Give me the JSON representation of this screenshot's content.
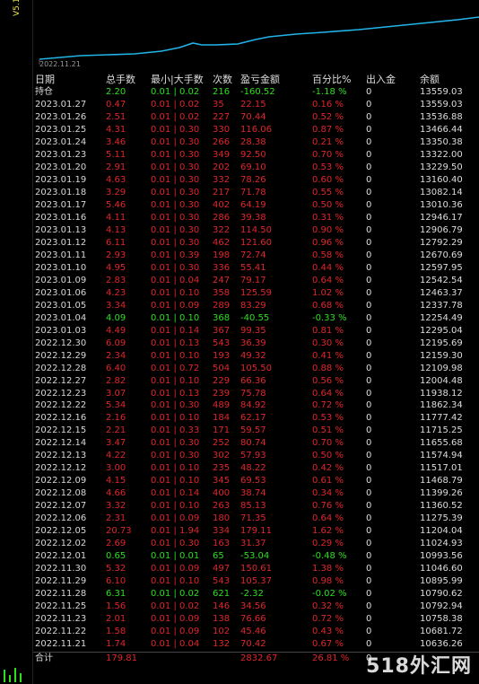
{
  "version": "V5.15",
  "chart_date": "2022.11.21",
  "watermark": "518外汇网",
  "header": [
    "日期",
    "总手数",
    "最小|大手数",
    "次数",
    "盈亏金额",
    "百分比%",
    "出入金",
    "余额"
  ],
  "open_row": {
    "date": "持仓",
    "lots": "2.20",
    "minmax": "0.01 | 0.02",
    "count": "216",
    "pl": "-160.52",
    "pct": "-1.18 %",
    "flow": "0",
    "balance": "13559.03"
  },
  "rows": [
    [
      "2023.01.27",
      "0.47",
      "0.01 | 0.02",
      "35",
      "22.15",
      "0.16 %",
      "0",
      "13559.03"
    ],
    [
      "2023.01.26",
      "2.51",
      "0.01 | 0.02",
      "227",
      "70.44",
      "0.52 %",
      "0",
      "13536.88"
    ],
    [
      "2023.01.25",
      "4.31",
      "0.01 | 0.30",
      "330",
      "116.06",
      "0.87 %",
      "0",
      "13466.44"
    ],
    [
      "2023.01.24",
      "3.46",
      "0.01 | 0.30",
      "266",
      "28.38",
      "0.21 %",
      "0",
      "13350.38"
    ],
    [
      "2023.01.23",
      "5.11",
      "0.01 | 0.30",
      "349",
      "92.50",
      "0.70 %",
      "0",
      "13322.00"
    ],
    [
      "2023.01.20",
      "2.91",
      "0.01 | 0.30",
      "202",
      "69.10",
      "0.53 %",
      "0",
      "13229.50"
    ],
    [
      "2023.01.19",
      "4.63",
      "0.01 | 0.30",
      "332",
      "78.26",
      "0.60 %",
      "0",
      "13160.40"
    ],
    [
      "2023.01.18",
      "3.29",
      "0.01 | 0.30",
      "217",
      "71.78",
      "0.55 %",
      "0",
      "13082.14"
    ],
    [
      "2023.01.17",
      "5.46",
      "0.01 | 0.30",
      "402",
      "64.19",
      "0.50 %",
      "0",
      "13010.36"
    ],
    [
      "2023.01.16",
      "4.11",
      "0.01 | 0.30",
      "286",
      "39.38",
      "0.31 %",
      "0",
      "12946.17"
    ],
    [
      "2023.01.13",
      "4.13",
      "0.01 | 0.30",
      "322",
      "114.50",
      "0.90 %",
      "0",
      "12906.79"
    ],
    [
      "2023.01.12",
      "6.11",
      "0.01 | 0.30",
      "462",
      "121.60",
      "0.96 %",
      "0",
      "12792.29"
    ],
    [
      "2023.01.11",
      "2.93",
      "0.01 | 0.39",
      "198",
      "72.74",
      "0.58 %",
      "0",
      "12670.69"
    ],
    [
      "2023.01.10",
      "4.95",
      "0.01 | 0.30",
      "336",
      "55.41",
      "0.44 %",
      "0",
      "12597.95"
    ],
    [
      "2023.01.09",
      "2.83",
      "0.01 | 0.04",
      "247",
      "79.17",
      "0.64 %",
      "0",
      "12542.54"
    ],
    [
      "2023.01.06",
      "4.23",
      "0.01 | 0.10",
      "358",
      "125.59",
      "1.02 %",
      "0",
      "12463.37"
    ],
    [
      "2023.01.05",
      "3.34",
      "0.01 | 0.09",
      "289",
      "83.29",
      "0.68 %",
      "0",
      "12337.78"
    ],
    [
      "2023.01.04",
      "4.09",
      "0.01 | 0.10",
      "368",
      "-40.55",
      "-0.33 %",
      "0",
      "12254.49"
    ],
    [
      "2023.01.03",
      "4.49",
      "0.01 | 0.14",
      "367",
      "99.35",
      "0.81 %",
      "0",
      "12295.04"
    ],
    [
      "2022.12.30",
      "6.09",
      "0.01 | 0.13",
      "543",
      "36.39",
      "0.30 %",
      "0",
      "12195.69"
    ],
    [
      "2022.12.29",
      "2.34",
      "0.01 | 0.10",
      "193",
      "49.32",
      "0.41 %",
      "0",
      "12159.30"
    ],
    [
      "2022.12.28",
      "6.40",
      "0.01 | 0.72",
      "504",
      "105.50",
      "0.88 %",
      "0",
      "12109.98"
    ],
    [
      "2022.12.27",
      "2.82",
      "0.01 | 0.10",
      "229",
      "66.36",
      "0.56 %",
      "0",
      "12004.48"
    ],
    [
      "2022.12.23",
      "3.07",
      "0.01 | 0.13",
      "239",
      "75.78",
      "0.64 %",
      "0",
      "11938.12"
    ],
    [
      "2022.12.22",
      "5.34",
      "0.01 | 0.30",
      "489",
      "84.92",
      "0.72 %",
      "0",
      "11862.34"
    ],
    [
      "2022.12.16",
      "2.16",
      "0.01 | 0.10",
      "184",
      "62.17",
      "0.53 %",
      "0",
      "11777.42"
    ],
    [
      "2022.12.15",
      "2.21",
      "0.01 | 0.33",
      "171",
      "59.57",
      "0.51 %",
      "0",
      "11715.25"
    ],
    [
      "2022.12.14",
      "3.47",
      "0.01 | 0.30",
      "252",
      "80.74",
      "0.70 %",
      "0",
      "11655.68"
    ],
    [
      "2022.12.13",
      "4.22",
      "0.01 | 0.30",
      "302",
      "57.93",
      "0.50 %",
      "0",
      "11574.94"
    ],
    [
      "2022.12.12",
      "3.00",
      "0.01 | 0.10",
      "235",
      "48.22",
      "0.42 %",
      "0",
      "11517.01"
    ],
    [
      "2022.12.09",
      "4.15",
      "0.01 | 0.10",
      "345",
      "69.53",
      "0.61 %",
      "0",
      "11468.79"
    ],
    [
      "2022.12.08",
      "4.66",
      "0.01 | 0.14",
      "400",
      "38.74",
      "0.34 %",
      "0",
      "11399.26"
    ],
    [
      "2022.12.07",
      "3.32",
      "0.01 | 0.10",
      "263",
      "85.13",
      "0.76 %",
      "0",
      "11360.52"
    ],
    [
      "2022.12.06",
      "2.31",
      "0.01 | 0.09",
      "180",
      "71.35",
      "0.64 %",
      "0",
      "11275.39"
    ],
    [
      "2022.12.05",
      "20.73",
      "0.01 | 1.94",
      "334",
      "179.11",
      "1.62 %",
      "0",
      "11204.04"
    ],
    [
      "2022.12.02",
      "2.69",
      "0.01 | 0.30",
      "163",
      "31.37",
      "0.29 %",
      "0",
      "11024.93"
    ],
    [
      "2022.12.01",
      "0.65",
      "0.01 | 0.01",
      "65",
      "-53.04",
      "-0.48 %",
      "0",
      "10993.56"
    ],
    [
      "2022.11.30",
      "5.32",
      "0.01 | 0.09",
      "497",
      "150.61",
      "1.38 %",
      "0",
      "11046.60"
    ],
    [
      "2022.11.29",
      "6.10",
      "0.01 | 0.10",
      "543",
      "105.37",
      "0.98 %",
      "0",
      "10895.99"
    ],
    [
      "2022.11.28",
      "6.31",
      "0.01 | 0.02",
      "621",
      "-2.32",
      "-0.02 %",
      "0",
      "10790.62"
    ],
    [
      "2022.11.25",
      "1.56",
      "0.01 | 0.02",
      "146",
      "34.56",
      "0.32 %",
      "0",
      "10792.94"
    ],
    [
      "2022.11.23",
      "2.01",
      "0.01 | 0.09",
      "138",
      "76.66",
      "0.72 %",
      "0",
      "10758.38"
    ],
    [
      "2022.11.22",
      "1.58",
      "0.01 | 0.09",
      "102",
      "45.46",
      "0.43 %",
      "0",
      "10681.72"
    ],
    [
      "2022.11.21",
      "1.74",
      "0.01 | 0.04",
      "132",
      "70.42",
      "0.67 %",
      "0",
      "10636.26"
    ]
  ],
  "total_row": {
    "date": "合计",
    "lots": "179.81",
    "pl": "2832.67",
    "pct": "26.81 %",
    "flow": "0"
  },
  "colors": {
    "profit": "#e0262b",
    "loss": "#2de01f",
    "line": "#22b4e8",
    "text": "#d7d7d7"
  }
}
